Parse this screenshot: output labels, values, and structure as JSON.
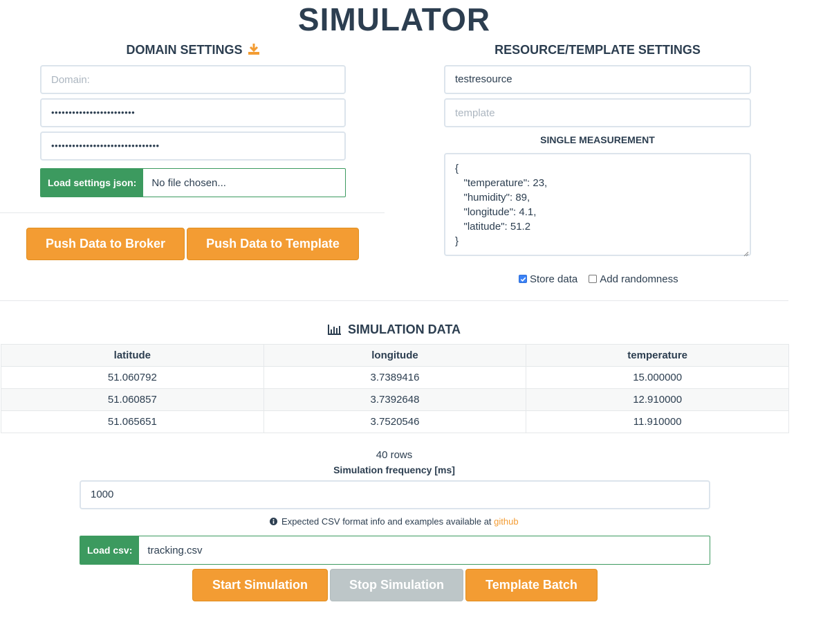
{
  "title": "SIMULATOR",
  "domain_settings": {
    "heading": "DOMAIN SETTINGS",
    "domain_placeholder": "Domain:",
    "field2_masked": "••••••••••••••••••••••••",
    "field3_masked": "•••••••••••••••••••••••••••••••",
    "load_label": "Load settings json:",
    "load_value": "No file chosen..."
  },
  "actions": {
    "push_broker": "Push Data to Broker",
    "push_template": "Push Data to Template"
  },
  "resource_settings": {
    "heading": "RESOURCE/TEMPLATE SETTINGS",
    "resource_value": "testresource",
    "template_placeholder": "template",
    "single_heading": "SINGLE MEASUREMENT",
    "measurement_json": "{\n   \"temperature\": 23,\n   \"humidity\": 89,\n   \"longitude\": 4.1,\n   \"latitude\": 51.2\n}",
    "store_data_label": "Store data",
    "add_randomness_label": "Add randomness"
  },
  "simulation": {
    "heading": "SIMULATION DATA",
    "columns": [
      "latitude",
      "longitude",
      "temperature"
    ],
    "rows": [
      [
        "51.060792",
        "3.7389416",
        "15.000000"
      ],
      [
        "51.060857",
        "3.7392648",
        "12.910000"
      ],
      [
        "51.065651",
        "3.7520546",
        "11.910000"
      ]
    ],
    "row_count": "40 rows",
    "frequency_label": "Simulation frequency [ms]",
    "frequency_value": "1000",
    "info_text": "Expected CSV format info and examples available at",
    "info_link": "github",
    "load_csv_label": "Load csv:",
    "load_csv_value": "tracking.csv",
    "start": "Start Simulation",
    "stop": "Stop Simulation",
    "batch": "Template Batch"
  },
  "colors": {
    "orange": "#f39c33",
    "green": "#3c9a5f",
    "disabled": "#bdc6c8",
    "text": "#2c3e50"
  },
  "icons": {
    "download": "download-icon",
    "bar_chart": "bar-chart-icon",
    "info": "info-circle-icon",
    "check": "checkmark"
  }
}
